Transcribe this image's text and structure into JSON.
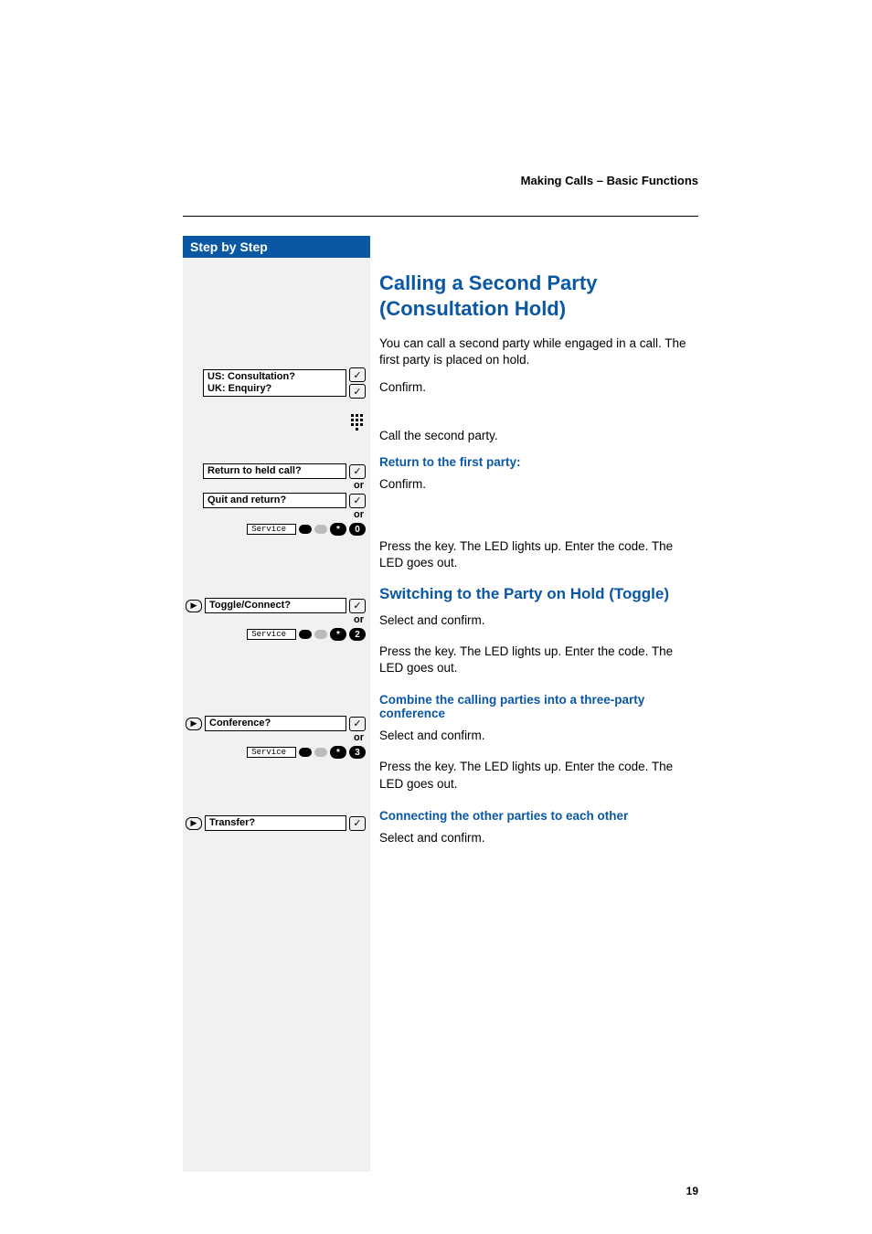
{
  "running_head": "Making Calls – Basic Functions",
  "sidebar": {
    "title": "Step by Step"
  },
  "page_number": "19",
  "h2": "Calling a Second Party (Consultation Hold)",
  "intro": "You can call a second party while engaged in a call. The first party is placed on hold.",
  "prompt1_line1": "US: Consultation?",
  "prompt1_line2": "UK: Enquiry?",
  "confirm": "Confirm.",
  "call_second": "Call the second party.",
  "sub_return_first": "Return to the first party:",
  "prompt2": "Return to held call?",
  "prompt3": "Quit and return?",
  "or": "or",
  "service": "Service",
  "star": "*",
  "code0": "0",
  "code2": "2",
  "code3": "3",
  "press_key": "Press the key. The LED lights up. Enter the code. The LED goes out.",
  "h3_toggle": "Switching to the Party on Hold (Toggle)",
  "prompt_toggle": "Toggle/Connect?",
  "select_confirm": "Select and confirm.",
  "sub_conf": "Combine the calling parties into a three-party conference",
  "prompt_conf": "Conference?",
  "sub_connect": "Connecting the other parties to each other",
  "prompt_transfer": "Transfer?"
}
